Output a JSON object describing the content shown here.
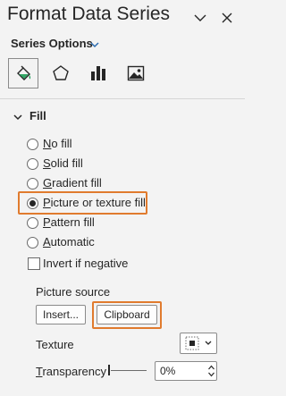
{
  "pane": {
    "title": "Format Data Series",
    "series_options_label": "Series Options"
  },
  "fill": {
    "section_label": "Fill",
    "options": [
      {
        "first": "N",
        "rest": "o fill",
        "checked": false
      },
      {
        "first": "S",
        "rest": "olid fill",
        "checked": false
      },
      {
        "first": "G",
        "rest": "radient fill",
        "checked": false
      },
      {
        "first": "P",
        "rest": "icture or texture fill",
        "checked": true
      },
      {
        "first": "P",
        "rest": "attern fill",
        "checked": false
      },
      {
        "first": "A",
        "rest": "utomatic",
        "checked": false
      }
    ],
    "invert_label": "Invert if negative"
  },
  "picture_source": {
    "label": "Picture source",
    "insert_label": "Insert...",
    "clipboard_label": "Clipboard"
  },
  "texture": {
    "label": "Texture"
  },
  "transparency": {
    "label": "Transparency",
    "value": "0%"
  },
  "colors": {
    "highlight": "#e07b2e",
    "background": "#f3f3f3"
  }
}
